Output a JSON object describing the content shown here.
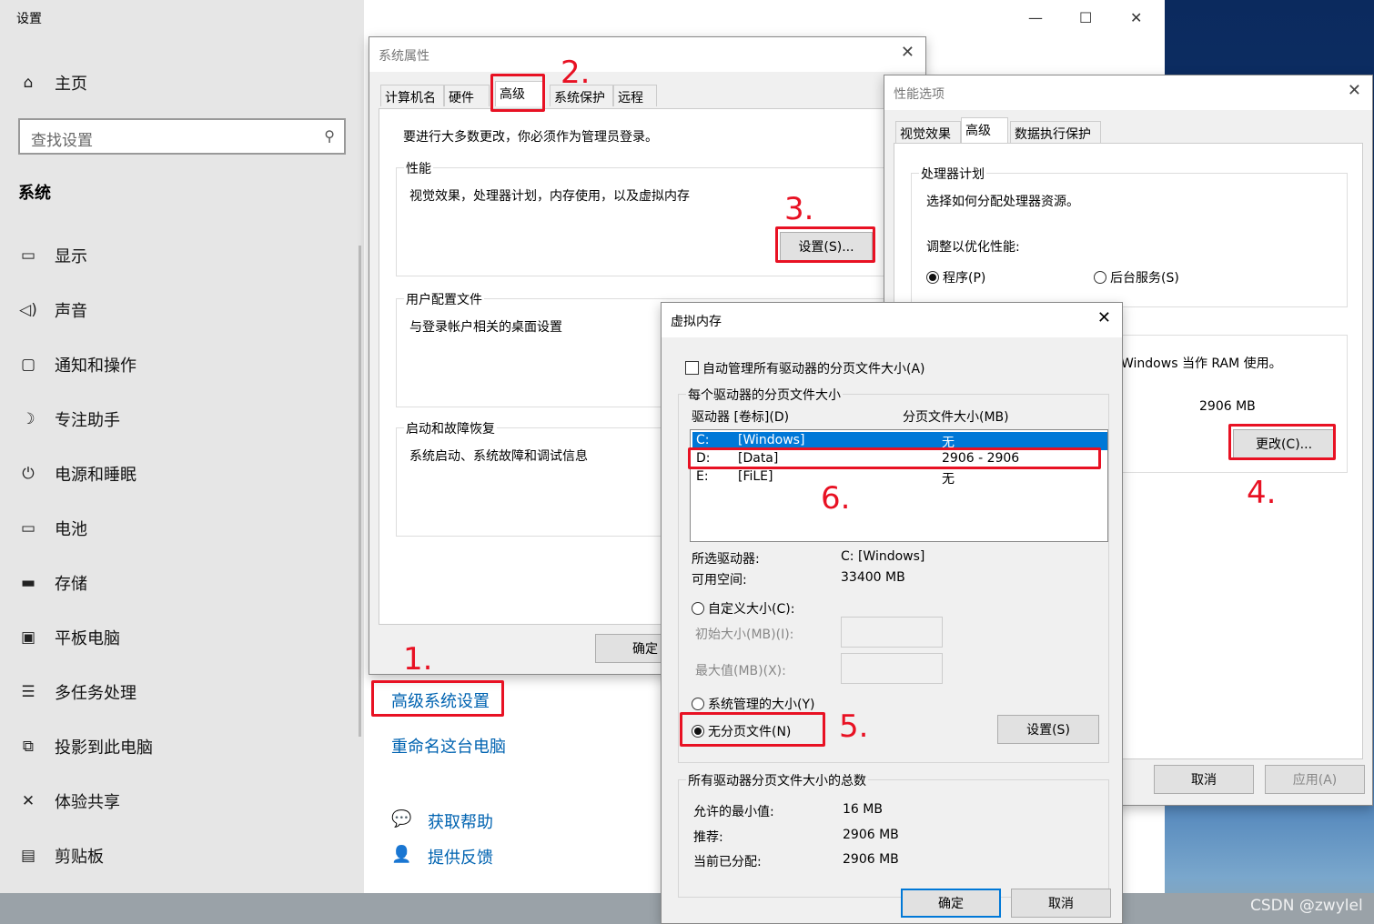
{
  "settings": {
    "title": "设置",
    "home": "主页",
    "search_placeholder": "查找设置",
    "section": "系统",
    "nav": [
      {
        "label": "显示",
        "icon": "monitor-icon"
      },
      {
        "label": "声音",
        "icon": "speaker-icon"
      },
      {
        "label": "通知和操作",
        "icon": "notification-icon"
      },
      {
        "label": "专注助手",
        "icon": "moon-icon"
      },
      {
        "label": "电源和睡眠",
        "icon": "power-icon"
      },
      {
        "label": "电池",
        "icon": "battery-icon"
      },
      {
        "label": "存储",
        "icon": "storage-icon"
      },
      {
        "label": "平板电脑",
        "icon": "tablet-icon"
      },
      {
        "label": "多任务处理",
        "icon": "multitask-icon"
      },
      {
        "label": "投影到此电脑",
        "icon": "project-icon"
      },
      {
        "label": "体验共享",
        "icon": "share-icon"
      },
      {
        "label": "剪贴板",
        "icon": "clipboard-icon"
      }
    ],
    "links": {
      "advanced": "高级系统设置",
      "rename": "重命名这台电脑",
      "help": "获取帮助",
      "feedback": "提供反馈"
    }
  },
  "sysprops": {
    "title": "系统属性",
    "tabs": [
      "计算机名",
      "硬件",
      "高级",
      "系统保护",
      "远程"
    ],
    "admin_note": "要进行大多数更改，你必须作为管理员登录。",
    "perf": {
      "label": "性能",
      "desc": "视觉效果，处理器计划，内存使用，以及虚拟内存",
      "button": "设置(S)..."
    },
    "profile": {
      "label": "用户配置文件",
      "desc": "与登录帐户相关的桌面设置"
    },
    "startup": {
      "label": "启动和故障恢复",
      "desc": "系统启动、系统故障和调试信息"
    },
    "ok": "确定"
  },
  "perfopts": {
    "title": "性能选项",
    "tabs": [
      "视觉效果",
      "高级",
      "数据执行保护"
    ],
    "cpu_group": "处理器计划",
    "cpu_desc": "选择如何分配处理器资源。",
    "adjust": "调整以优化性能:",
    "radio_program": "程序(P)",
    "radio_service": "后台服务(S)",
    "vm_desc": "Windows 当作 RAM 使用。",
    "vm_size": "2906 MB",
    "change": "更改(C)...",
    "cancel": "取消",
    "apply": "应用(A)"
  },
  "vmem": {
    "title": "虚拟内存",
    "auto": "自动管理所有驱动器的分页文件大小(A)",
    "per_drive": "每个驱动器的分页文件大小",
    "col_drive": "驱动器 [卷标](D)",
    "col_size": "分页文件大小(MB)",
    "drives": [
      {
        "letter": "C:",
        "label": "[Windows]",
        "size": "无"
      },
      {
        "letter": "D:",
        "label": "[Data]",
        "size": "2906 - 2906"
      },
      {
        "letter": "E:",
        "label": "[FiLE]",
        "size": "无"
      }
    ],
    "selected_label": "所选驱动器:",
    "selected_value": "C:  [Windows]",
    "free_label": "可用空间:",
    "free_value": "33400 MB",
    "custom": "自定义大小(C):",
    "initial": "初始大小(MB)(I):",
    "max": "最大值(MB)(X):",
    "system_managed": "系统管理的大小(Y)",
    "no_paging": "无分页文件(N)",
    "set": "设置(S)",
    "total_group": "所有驱动器分页文件大小的总数",
    "min_label": "允许的最小值:",
    "min_value": "16 MB",
    "rec_label": "推荐:",
    "rec_value": "2906 MB",
    "cur_label": "当前已分配:",
    "cur_value": "2906 MB",
    "ok": "确定",
    "cancel": "取消"
  },
  "steps": [
    "1.",
    "2.",
    "3.",
    "4.",
    "5.",
    "6."
  ],
  "watermark": "CSDN @zwylel"
}
